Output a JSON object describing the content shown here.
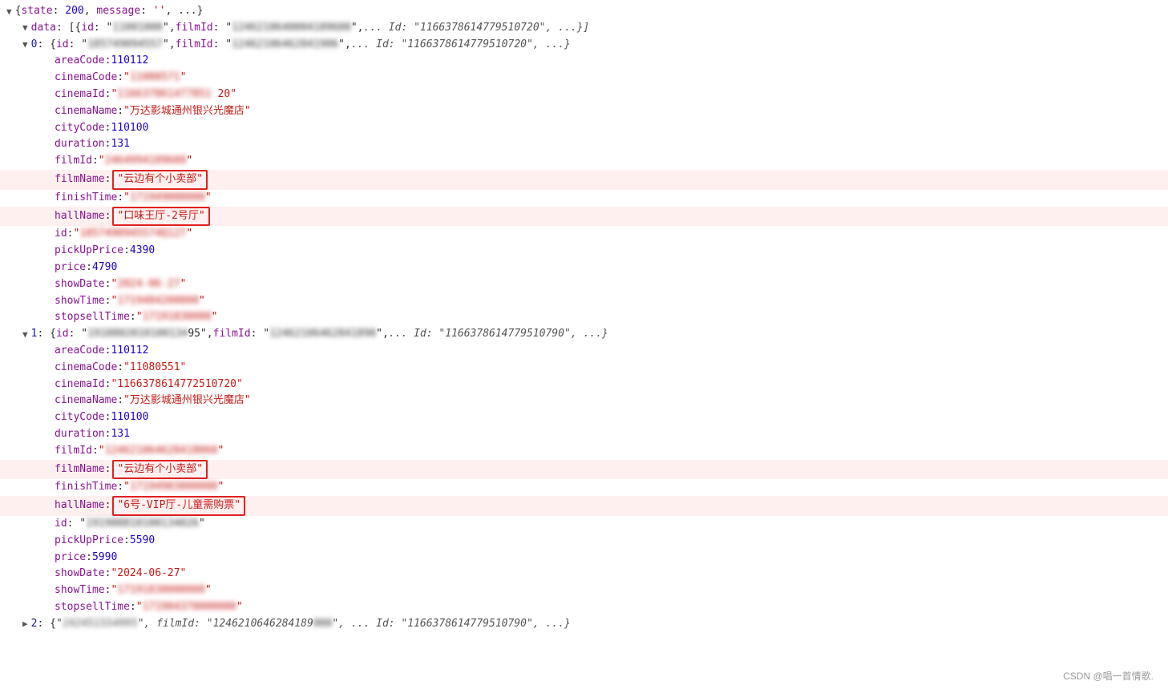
{
  "watermark": "CSDN @唱一首情歌.",
  "lines": [
    {
      "id": "state",
      "indent": 0,
      "content": "▼ {state: 200, message: '', ...}",
      "type": "state-header"
    },
    {
      "id": "data-header",
      "indent": 0,
      "content": "data",
      "type": "data-header"
    },
    {
      "id": "item0-header",
      "indent": 1,
      "content": "item0-header",
      "type": "item-header",
      "index": 0
    },
    {
      "id": "areaCode-0",
      "indent": 2,
      "key": "areaCode",
      "value": "110112",
      "vtype": "number"
    },
    {
      "id": "cinemaCode-0",
      "indent": 2,
      "key": "cinemaCode",
      "value_blurred": true,
      "value_prefix": "\"11",
      "value_middle": "00",
      "value_suffix": "\"",
      "vtype": "string"
    },
    {
      "id": "cinemaId-0",
      "indent": 2,
      "key": "cinemaId",
      "value_blurred": true,
      "value_prefix": "\"116637861477851",
      "value_middle": "20",
      "value_suffix": "\"",
      "vtype": "string"
    },
    {
      "id": "cinemaName-0",
      "indent": 2,
      "key": "cinemaName",
      "value": "\"万达影城通州银兴光魔店\"",
      "vtype": "string"
    },
    {
      "id": "cityCode-0",
      "indent": 2,
      "key": "cityCode",
      "value": "110100",
      "vtype": "number"
    },
    {
      "id": "duration-0",
      "indent": 2,
      "key": "duration",
      "value": "131",
      "vtype": "number"
    },
    {
      "id": "filmId-0",
      "indent": 2,
      "key": "filmId",
      "value_blurred": true,
      "value_prefix": "\"",
      "value_middle": "2464994109600",
      "value_suffix": "\"",
      "vtype": "string"
    },
    {
      "id": "filmName-0",
      "indent": 2,
      "key": "filmName",
      "value": "\"云边有个小卖部\"",
      "vtype": "string",
      "highlighted": true
    },
    {
      "id": "finishTime-0",
      "indent": 2,
      "key": "finishTime",
      "value_blurred": true,
      "value_prefix": "\"171",
      "value_middle": "9490",
      "value_suffix": "000\"",
      "vtype": "string"
    },
    {
      "id": "hallName-0",
      "indent": 2,
      "key": "hallName",
      "value": "\"口味王厅-2号厅\"",
      "vtype": "string",
      "highlighted": true
    },
    {
      "id": "id-0",
      "indent": 2,
      "key": "id",
      "value_blurred": true,
      "value_prefix": "\"1857490945574Q127",
      "value_suffix": "\"",
      "vtype": "string"
    },
    {
      "id": "pickUpPrice-0",
      "indent": 2,
      "key": "pickUpPrice",
      "value": "4390",
      "vtype": "number"
    },
    {
      "id": "price-0",
      "indent": 2,
      "key": "price",
      "value": "4790",
      "vtype": "number"
    },
    {
      "id": "showDate-0",
      "indent": 2,
      "key": "showDate",
      "value_blurred": true,
      "value_prefix": "\"202",
      "value_middle": "4-06-27",
      "value_suffix": "\"",
      "vtype": "string"
    },
    {
      "id": "showTime-0",
      "indent": 2,
      "key": "showTime",
      "value_blurred": true,
      "value_prefix": "\"1719484",
      "value_middle": "200000",
      "value_suffix": "\"",
      "vtype": "string"
    },
    {
      "id": "stopsellTime-0",
      "indent": 2,
      "key": "stopsellTime",
      "value_blurred": true,
      "value_prefix": "\"17191",
      "value_middle": "83000",
      "value_suffix": "\"",
      "vtype": "string"
    },
    {
      "id": "item1-header",
      "indent": 1,
      "content": "item1-header",
      "type": "item-header",
      "index": 1
    },
    {
      "id": "areaCode-1",
      "indent": 2,
      "key": "areaCode",
      "value": "110112",
      "vtype": "number"
    },
    {
      "id": "cinemaCode-1",
      "indent": 2,
      "key": "cinemaCode",
      "value": "\"11080551\"",
      "vtype": "string"
    },
    {
      "id": "cinemaId-1",
      "indent": 2,
      "key": "cinemaId",
      "value": "\"1166378614772510720\"",
      "vtype": "string"
    },
    {
      "id": "cinemaName-1",
      "indent": 2,
      "key": "cinemaName",
      "value": "\"万达影城通州银兴光魔店\"",
      "vtype": "string"
    },
    {
      "id": "cityCode-1",
      "indent": 2,
      "key": "cityCode",
      "value": "110100",
      "vtype": "number"
    },
    {
      "id": "duration-1",
      "indent": 2,
      "key": "duration",
      "value": "131",
      "vtype": "number"
    },
    {
      "id": "filmId-1",
      "indent": 2,
      "key": "filmId",
      "value_blurred": true,
      "value_prefix": "\"1",
      "value_middle": "24621064628418060",
      "value_suffix": "\"",
      "vtype": "string"
    },
    {
      "id": "filmName-1",
      "indent": 2,
      "key": "filmName",
      "value": "\"云边有个小卖部\"",
      "vtype": "string",
      "highlighted": true
    },
    {
      "id": "finishTime-1",
      "indent": 2,
      "key": "finishTime",
      "value_blurred": true,
      "value_prefix": "\"17",
      "value_middle": "19490300000",
      "value_suffix": "\"",
      "vtype": "string"
    },
    {
      "id": "hallName-1",
      "indent": 2,
      "key": "hallName",
      "value": "\"6号-VIP厅-儿童需购票\"",
      "vtype": "string",
      "highlighted": true
    },
    {
      "id": "id-1",
      "indent": 2,
      "key": "id",
      "value_blurred": true,
      "value_prefix": "\"1",
      "value_middle": "91900810100134026",
      "value_suffix": "\"",
      "vtype": "string"
    },
    {
      "id": "pickUpPrice-1",
      "indent": 2,
      "key": "pickUpPrice",
      "value": "5590",
      "vtype": "number"
    },
    {
      "id": "price-1",
      "indent": 2,
      "key": "price",
      "value": "5990",
      "vtype": "number"
    },
    {
      "id": "showDate-1",
      "indent": 2,
      "key": "showDate",
      "value": "\"2024-06-27\"",
      "vtype": "string"
    },
    {
      "id": "showTime-1",
      "indent": 2,
      "key": "showTime",
      "value_blurred": true,
      "value_prefix": "\"171",
      "value_middle": "9183000000",
      "value_suffix": "\"",
      "vtype": "string"
    },
    {
      "id": "stopsellTime-1",
      "indent": 2,
      "key": "stopsellTime",
      "value_blurred": true,
      "value_prefix": "\"171904370",
      "value_middle": "0000",
      "value_suffix": "\"",
      "vtype": "string"
    },
    {
      "id": "item2-header",
      "indent": 1,
      "content": "item2-header",
      "type": "item-header",
      "index": 2,
      "collapsed": true
    }
  ]
}
